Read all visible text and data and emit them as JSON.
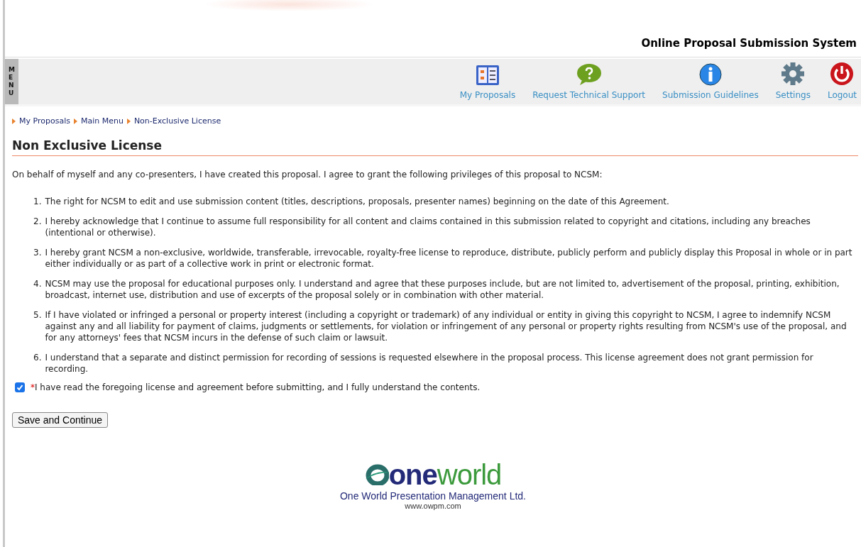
{
  "header": {
    "title": "Online Proposal Submission System"
  },
  "menu_tab": {
    "label": "MENU"
  },
  "nav": [
    {
      "kind": "proposals",
      "label": "My Proposals"
    },
    {
      "kind": "support",
      "label": "Request Technical Support"
    },
    {
      "kind": "guidelines",
      "label": "Submission Guidelines"
    },
    {
      "kind": "settings",
      "label": "Settings"
    },
    {
      "kind": "logout",
      "label": "Logout"
    }
  ],
  "breadcrumb": [
    "My Proposals",
    "Main Menu",
    "Non-Exclusive License"
  ],
  "heading": "Non Exclusive License",
  "intro": "On behalf of myself and any co-presenters, I have created this proposal. I agree to grant the following privileges of this proposal to NCSM:",
  "terms": [
    {
      "number": "1.",
      "text": "The right for NCSM to edit and use submission content (titles, descriptions, proposals, presenter names) beginning on the date of this Agreement."
    },
    {
      "number": "2.",
      "text": "I hereby acknowledge that I continue to assume full responsibility for all content and claims contained in this submission related to copyright and citations, including any breaches (intentional or otherwise)."
    },
    {
      "number": "3.",
      "text": "I hereby grant NCSM a non-exclusive, worldwide, transferable, irrevocable, royalty-free license to reproduce, distribute, publicly perform and publicly display this Proposal in whole or in part either individually or as part of a collective work in print or electronic format."
    },
    {
      "number": "4.",
      "text": "NCSM may use the proposal for educational purposes only. I understand and agree that these purposes include, but are not limited to, advertisement of the proposal, printing, exhibition, broadcast, internet use, distribution and use of excerpts of the proposal solely or in combination with other material."
    },
    {
      "number": "5.",
      "text": "If I have violated or infringed a personal or property interest (including a copyright or trademark) of any individual or entity in giving this copyright to NCSM, I agree to indemnify NCSM against any and all liability for payment of claims, judgments or settlements, for violation or infringement of any personal or property rights resulting from NCSM's use of the proposal, and for any attorneys' fees that NCSM incurs in the defense of such claim or lawsuit."
    },
    {
      "number": "6.",
      "text": "I understand that a separate and distinct permission for recording of sessions is requested elsewhere in the proposal process. This license agreement does not grant permission for recording."
    }
  ],
  "agreement": {
    "required_mark": "*",
    "label": "I have read the foregoing license and agreement before submitting, and I fully understand the contents.",
    "checked": true
  },
  "submit_button": "Save and Continue",
  "footer": {
    "logo_parts": [
      "one",
      "world"
    ],
    "company": "One World Presentation Management Ltd.",
    "url": "www.owpm.com"
  }
}
